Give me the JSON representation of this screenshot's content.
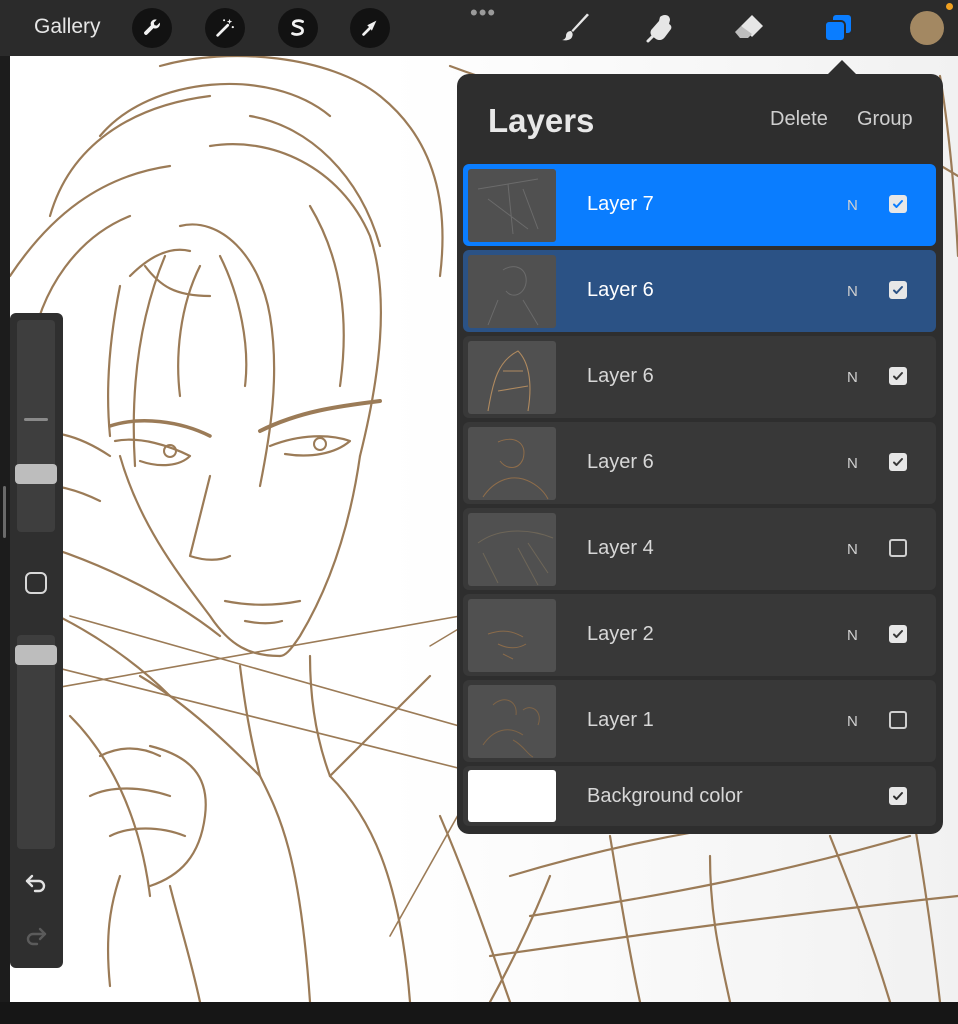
{
  "toolbar": {
    "gallery_label": "Gallery",
    "more_label": "•••",
    "left_icons": [
      "wrench-icon",
      "magic-wand-icon",
      "selection-icon",
      "transform-arrow-icon"
    ],
    "right_icons": [
      "brush-icon",
      "smudge-icon",
      "eraser-icon",
      "layers-icon"
    ],
    "active_tool_color": "#0a7dff",
    "color_swatch": "#a38862"
  },
  "layers_panel": {
    "title": "Layers",
    "delete_label": "Delete",
    "group_label": "Group",
    "layers": [
      {
        "name": "Layer 7",
        "blend": "N",
        "visible": true,
        "state": "active"
      },
      {
        "name": "Layer 6",
        "blend": "N",
        "visible": true,
        "state": "secondary"
      },
      {
        "name": "Layer 6",
        "blend": "N",
        "visible": true,
        "state": "normal"
      },
      {
        "name": "Layer 6",
        "blend": "N",
        "visible": true,
        "state": "normal"
      },
      {
        "name": "Layer 4",
        "blend": "N",
        "visible": false,
        "state": "normal"
      },
      {
        "name": "Layer 2",
        "blend": "N",
        "visible": true,
        "state": "normal"
      },
      {
        "name": "Layer 1",
        "blend": "N",
        "visible": false,
        "state": "normal"
      }
    ],
    "background": {
      "name": "Background color",
      "visible": true,
      "color": "#ffffff"
    }
  },
  "sidebar": {
    "brush_size_level": 0.22,
    "opacity_level": 0.95,
    "icons": [
      "modify-square-icon",
      "undo-icon",
      "redo-icon"
    ]
  },
  "sketch_color": "#9b7b57"
}
